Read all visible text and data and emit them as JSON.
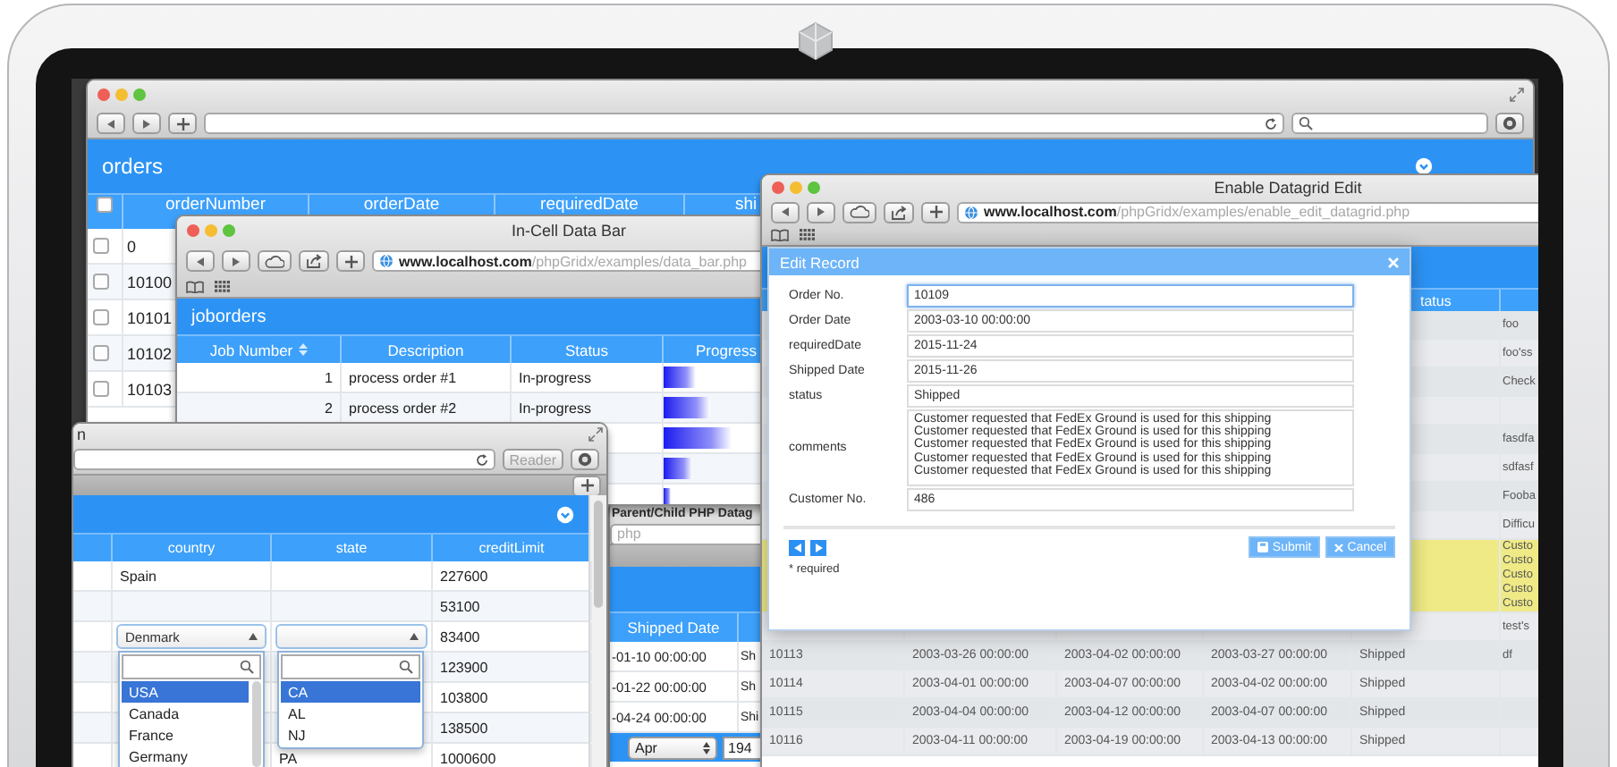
{
  "orders_window": {
    "grid": {
      "title": "orders",
      "header_checked": false,
      "columns": [
        "orderNumber",
        "orderDate",
        "requiredDate",
        "shi"
      ],
      "rows": [
        {
          "order_number": "0",
          "checked": false
        },
        {
          "order_number": "10100",
          "checked": false
        },
        {
          "order_number": "10101",
          "checked": false
        },
        {
          "order_number": "10102",
          "checked": false
        },
        {
          "order_number": "10103",
          "checked": false
        }
      ]
    }
  },
  "parent_child_window": {
    "title": "Parent/Child PHP Datag",
    "url": "php",
    "columns": [
      "Shipped Date"
    ],
    "rows": [
      {
        "shipped_date": "-01-10 00:00:00",
        "status": "Sh"
      },
      {
        "shipped_date": "-01-22 00:00:00",
        "status": "Sh"
      },
      {
        "shipped_date": "-04-24 00:00:00",
        "status": "Shi"
      }
    ],
    "month_select": "Apr",
    "year_field": "194"
  },
  "databar_window": {
    "title": "In-Cell Data Bar",
    "url": "**www.localhost.com**/phpGridx/examples/data_bar.php",
    "grid": {
      "title": "joborders",
      "columns": [
        "Job Number",
        "Description",
        "Status",
        "Progress"
      ],
      "rows": [
        {
          "job_number": "1",
          "description": "process order #1",
          "status": "In-progress",
          "level": 0.18
        },
        {
          "job_number": "2",
          "description": "process order #2",
          "status": "In-progress",
          "level": 0.26
        },
        {
          "level": 0.38
        },
        {
          "level": 0.16
        },
        {
          "level": 0.04
        }
      ]
    }
  },
  "edit_window": {
    "title": "Enable Datagrid Edit",
    "url": "**www.localhost.com**/phpGridx/examples/enable_edit_datagrid.php",
    "grid": {
      "header": {
        "status": "tatus"
      },
      "rows": [
        {
          "comments": [
            "foo"
          ],
          "selected": false
        },
        {
          "comments": [
            "foo'ss"
          ],
          "selected": false
        },
        {
          "comments": [
            "Check"
          ],
          "selected": false
        },
        {
          "selected": false
        },
        {
          "comments": [
            "fasdfa"
          ],
          "selected": false
        },
        {
          "comments": [
            "sdfasf"
          ],
          "selected": false
        },
        {
          "comments": [
            "Fooba"
          ],
          "selected": false
        },
        {
          "comments": [
            "Difficu"
          ],
          "selected": false
        },
        {
          "comments": [
            "Custo",
            "Custo",
            "Custo",
            "Custo",
            "Custo"
          ],
          "selected": true
        },
        {
          "comments": [
            "test's"
          ],
          "selected": false
        },
        {
          "number": "10113",
          "order_date": "2003-03-26 00:00:00",
          "required_date": "2003-04-02 00:00:00",
          "shipped_date": "2003-03-27 00:00:00",
          "status": "Shipped",
          "comments": [
            "df"
          ],
          "selected": false
        },
        {
          "number": "10114",
          "order_date": "2003-04-01 00:00:00",
          "required_date": "2003-04-07 00:00:00",
          "shipped_date": "2003-04-02 00:00:00",
          "status": "Shipped",
          "selected": false
        },
        {
          "number": "10115",
          "order_date": "2003-04-04 00:00:00",
          "required_date": "2003-04-12 00:00:00",
          "shipped_date": "2003-04-07 00:00:00",
          "status": "Shipped",
          "selected": false
        },
        {
          "number": "10116",
          "order_date": "2003-04-11 00:00:00",
          "required_date": "2003-04-19 00:00:00",
          "shipped_date": "2003-04-13 00:00:00",
          "status": "Shipped",
          "selected": false
        }
      ]
    },
    "dialog": {
      "title": "Edit Record",
      "fields": [
        {
          "kind": "input",
          "label": "Order No.",
          "value": "10109",
          "focused": true
        },
        {
          "kind": "input",
          "label": "Order Date",
          "value": "2003-03-10 00:00:00",
          "focused": false
        },
        {
          "kind": "input",
          "label": "requiredDate",
          "value": "2015-11-24",
          "focused": false
        },
        {
          "kind": "input",
          "label": "Shipped Date",
          "value": "2015-11-26",
          "focused": false
        },
        {
          "kind": "input",
          "label": "status",
          "value": "Shipped",
          "focused": false
        },
        {
          "kind": "textarea",
          "label": "comments",
          "lines": [
            "Customer requested that FedEx Ground is used for this shipping",
            "Customer requested that FedEx Ground is used for this shipping",
            "Customer requested that FedEx Ground is used for this shipping",
            "Customer requested that FedEx Ground is used for this shipping",
            "Customer requested that FedEx Ground is used for this shipping"
          ],
          "focused": false
        },
        {
          "kind": "input",
          "label": "Customer No.",
          "value": "486",
          "focused": false
        }
      ],
      "buttons": [
        {
          "kind": "submit",
          "label": "Submit"
        },
        {
          "kind": "cancel",
          "label": "Cancel"
        }
      ],
      "note": "* required"
    }
  },
  "customers_window": {
    "title": "n",
    "reader_button": "Reader",
    "grid": {
      "columns": [
        "country",
        "state",
        "creditLimit"
      ],
      "rows": [
        {
          "kind": "view",
          "country": "Spain",
          "credit_limit": "227600"
        },
        {
          "kind": "view",
          "credit_limit": "53100"
        },
        {
          "kind": "edit",
          "credit_limit": "83400",
          "country_select": {
            "value": "Denmark",
            "options": [
              {
                "label": "USA",
                "selected": true
              },
              {
                "label": "Canada",
                "selected": false
              },
              {
                "label": "France",
                "selected": false
              },
              {
                "label": "Germany",
                "selected": false
              }
            ]
          },
          "state_select": {
            "options": [
              {
                "label": "CA",
                "selected": true
              },
              {
                "label": "AL",
                "selected": false
              },
              {
                "label": "NJ",
                "selected": false
              }
            ]
          }
        },
        {
          "kind": "view",
          "credit_limit": "123900"
        },
        {
          "kind": "view",
          "credit_limit": "103800"
        },
        {
          "kind": "view",
          "credit_limit": "138500"
        },
        {
          "kind": "view",
          "state": "PA",
          "credit_limit": "1000600"
        }
      ]
    }
  }
}
